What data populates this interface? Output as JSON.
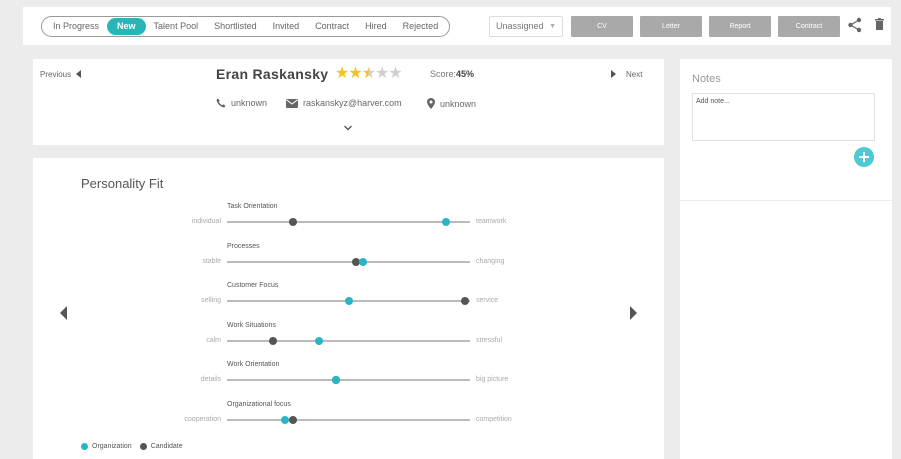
{
  "tabs": [
    {
      "label": "In Progress",
      "active": false
    },
    {
      "label": "New",
      "active": true
    },
    {
      "label": "Talent Pool",
      "active": false
    },
    {
      "label": "Shortlisted",
      "active": false
    },
    {
      "label": "Invited",
      "active": false
    },
    {
      "label": "Contract",
      "active": false
    },
    {
      "label": "Hired",
      "active": false
    },
    {
      "label": "Rejected",
      "active": false
    }
  ],
  "assignee": {
    "value": "Unassigned"
  },
  "documents": {
    "cv": "CV",
    "letter": "Letter",
    "report": "Report",
    "contract": "Contract"
  },
  "icons": {
    "share": "share-icon",
    "trash": "trash-icon"
  },
  "colors": {
    "accent": "#27b6b8",
    "organization": "#27b6c7",
    "candidate": "#555555",
    "star": "#f3c51b",
    "button": "#a9a9a9"
  },
  "candidate": {
    "previous": "Previous",
    "next": "Next",
    "name": "Eran Raskansky",
    "rating_stars": 2.5,
    "rating_max": 5,
    "score_label": "Score:",
    "score_value": "45%",
    "phone": "unknown",
    "email": "raskanskyz@harver.com",
    "location": "unknown"
  },
  "personality": {
    "title": "Personality Fit",
    "traits": [
      {
        "name": "Task Orientation",
        "left": "individual",
        "right": "teamwork",
        "candidate": 0.27,
        "organization": 0.9
      },
      {
        "name": "Processes",
        "left": "stable",
        "right": "changing",
        "candidate": 0.53,
        "organization": 0.56
      },
      {
        "name": "Customer Focus",
        "left": "selling",
        "right": "service",
        "candidate": 0.98,
        "organization": 0.5
      },
      {
        "name": "Work Situations",
        "left": "calm",
        "right": "stressful",
        "candidate": 0.19,
        "organization": 0.38
      },
      {
        "name": "Work Orientation",
        "left": "details",
        "right": "big picture",
        "candidate": 0.45,
        "organization": 0.45
      },
      {
        "name": "Organizational focus",
        "left": "cooperation",
        "right": "competition",
        "candidate": 0.27,
        "organization": 0.24
      }
    ],
    "legend": {
      "organization": "Organization",
      "candidate": "Candidate"
    }
  },
  "notes": {
    "title": "Notes",
    "placeholder": "Add note..."
  }
}
